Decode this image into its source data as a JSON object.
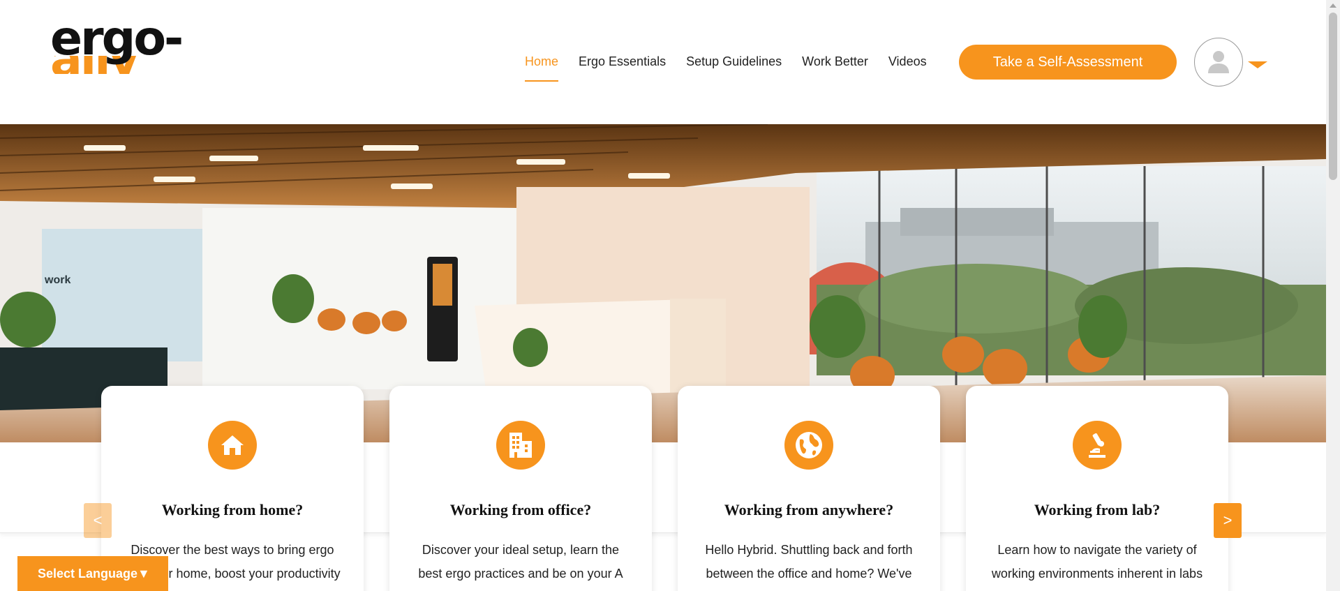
{
  "brand": {
    "logo_text": "ergo-",
    "logo_sub_text": "ally",
    "accent_color": "#f7941d"
  },
  "nav": {
    "items": [
      {
        "label": "Home",
        "active": true
      },
      {
        "label": "Ergo Essentials",
        "active": false
      },
      {
        "label": "Setup Guidelines",
        "active": false
      },
      {
        "label": "Work Better",
        "active": false
      },
      {
        "label": "Videos",
        "active": false
      }
    ]
  },
  "header": {
    "cta_label": "Take a Self-Assessment",
    "avatar_icon": "user-icon",
    "dropdown_icon": "caret-down-icon"
  },
  "hero": {
    "image": "office-lobby-photo",
    "wall_text": "work"
  },
  "cards": [
    {
      "icon": "home-icon",
      "title": "Working from home?",
      "text": "Discover the best ways to bring ergo into your home, boost your productivity and feel great."
    },
    {
      "icon": "office-building-icon",
      "title": "Working from office?",
      "text": "Discover your ideal setup, learn the best ergo practices and be on your A game at your desk."
    },
    {
      "icon": "globe-icon",
      "title": "Working from anywhere?",
      "text": "Hello Hybrid. Shuttling back and forth between the office and home? We've got you covered."
    },
    {
      "icon": "microscope-icon",
      "title": "Working from lab?",
      "text": "Learn how to navigate the variety of working environments inherent in labs and feel great."
    }
  ],
  "carousel": {
    "prev_label": "<",
    "next_label": ">"
  },
  "language": {
    "label": "Select Language▼"
  }
}
